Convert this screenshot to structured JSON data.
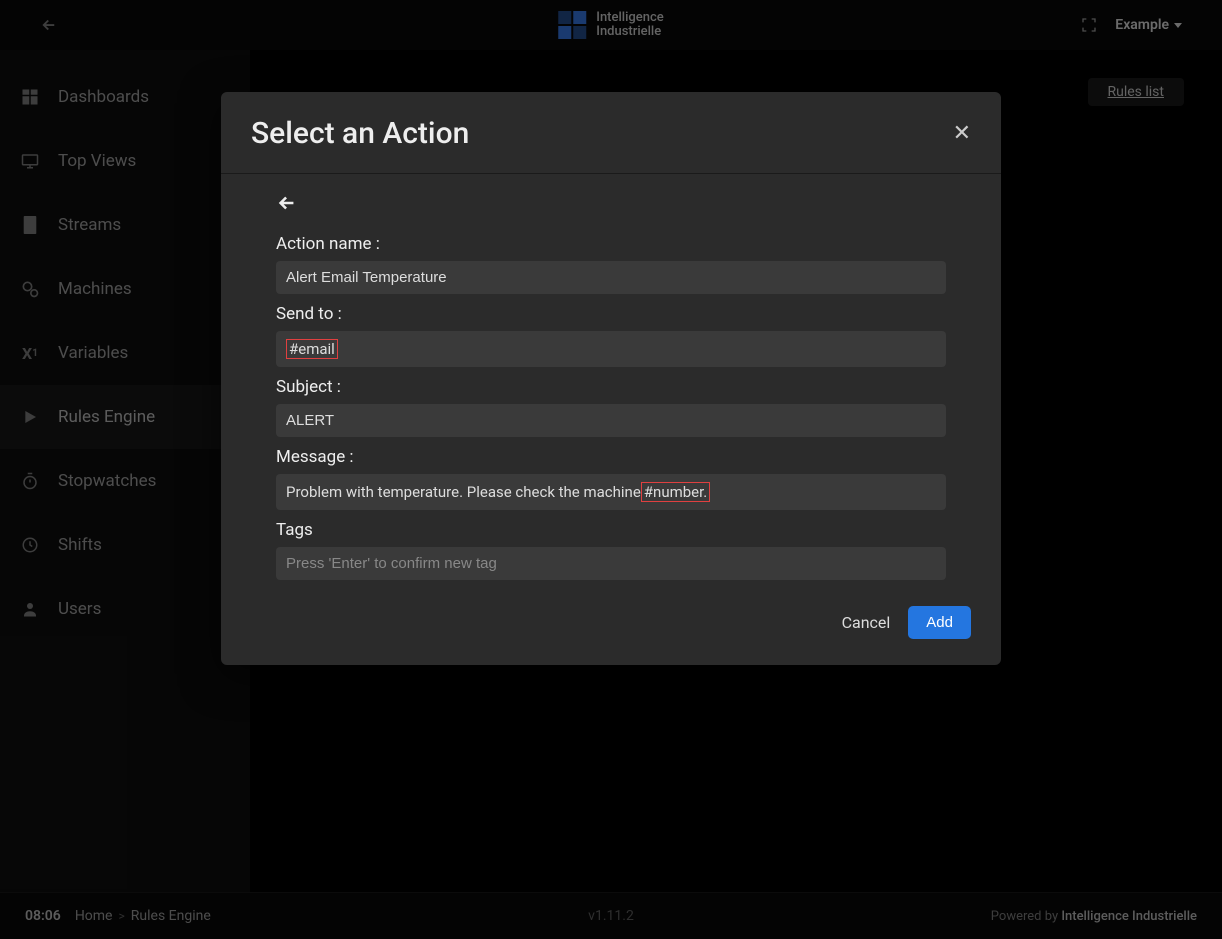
{
  "header": {
    "logo_line1": "Intelligence",
    "logo_line2": "Industrielle",
    "company": "Example"
  },
  "sidebar": {
    "items": [
      {
        "label": "Dashboards",
        "icon": "grid-icon"
      },
      {
        "label": "Top Views",
        "icon": "monitor-icon"
      },
      {
        "label": "Streams",
        "icon": "rect-icon"
      },
      {
        "label": "Machines",
        "icon": "gears-icon"
      },
      {
        "label": "Variables",
        "icon": "variable-icon"
      },
      {
        "label": "Rules Engine",
        "icon": "play-icon"
      },
      {
        "label": "Stopwatches",
        "icon": "stopwatch-icon"
      },
      {
        "label": "Shifts",
        "icon": "clock-icon"
      },
      {
        "label": "Users",
        "icon": "user-icon"
      }
    ],
    "active_index": 5
  },
  "content": {
    "rules_list_label": "Rules list"
  },
  "modal": {
    "title": "Select an Action",
    "labels": {
      "action_name": "Action name :",
      "send_to": "Send to :",
      "subject": "Subject :",
      "message": "Message :",
      "tags": "Tags"
    },
    "values": {
      "action_name": "Alert Email Temperature",
      "send_to_tag": "#email",
      "subject": "ALERT",
      "message_prefix": "Problem with temperature. Please check the machine ",
      "message_tag": "#number."
    },
    "tags_placeholder": "Press 'Enter' to confirm new tag",
    "buttons": {
      "cancel": "Cancel",
      "add": "Add"
    }
  },
  "footer": {
    "clock": "08:06",
    "crumb_home": "Home",
    "crumb_page": "Rules Engine",
    "version": "v1.11.2",
    "powered_prefix": "Powered by ",
    "powered_name": "Intelligence Industrielle"
  }
}
